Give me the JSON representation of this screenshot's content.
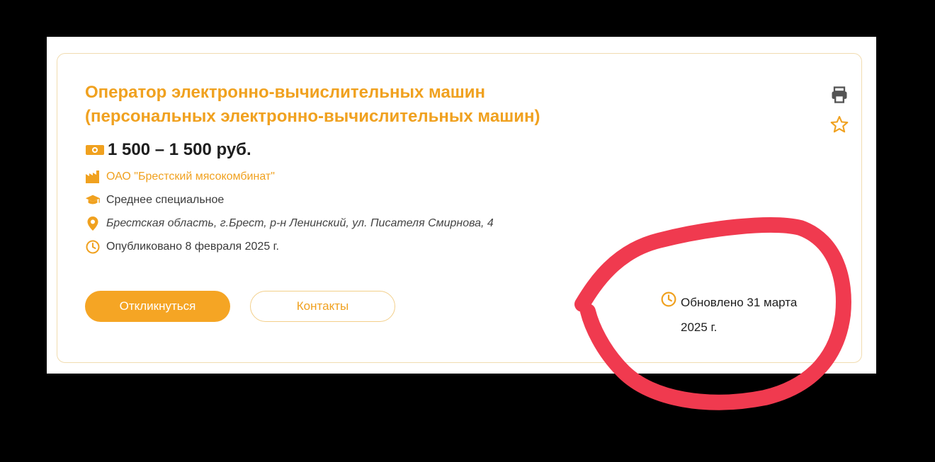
{
  "vacancy": {
    "title_line1": "Оператор электронно-вычислительных машин",
    "title_line2": "(персональных электронно-вычислительных машин)",
    "salary": "1 500 – 1 500 руб.",
    "company": "ОАО \"Брестский мясокомбинат\"",
    "education": "Среднее специальное",
    "address": "Брестская область, г.Брест, р-н Ленинский, ул. Писателя Смирнова, 4",
    "published": "Опубликовано 8 февраля 2025 г.",
    "updated_line1": "Обновлено 31 марта",
    "updated_line2": "2025 г."
  },
  "actions": {
    "respond_label": "Откликнуться",
    "contacts_label": "Контакты"
  },
  "icons": {
    "salary": "money-icon",
    "company": "factory-icon",
    "education": "graduation-cap-icon",
    "address": "location-pin-icon",
    "published": "clock-icon",
    "updated": "clock-icon",
    "print": "printer-icon",
    "favorite": "star-icon"
  },
  "colors": {
    "accent": "#f0a11f",
    "button": "#f5a524",
    "annotation": "#f03a4f"
  }
}
